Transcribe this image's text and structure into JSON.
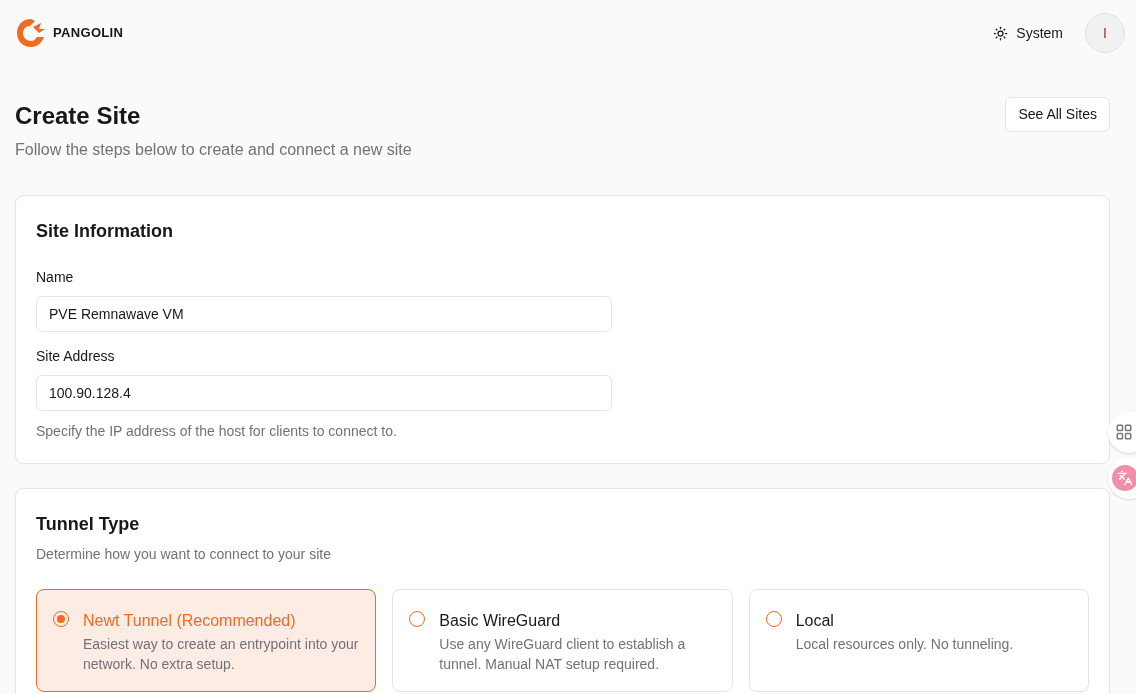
{
  "header": {
    "brand": "PANGOLIN",
    "theme_button": "System",
    "avatar": "I"
  },
  "page": {
    "title": "Create Site",
    "subtitle": "Follow the steps below to create and connect a new site",
    "see_all_button": "See All Sites"
  },
  "site_information": {
    "title": "Site Information",
    "fields": [
      {
        "label": "Name",
        "value": "PVE Remnawave VM"
      },
      {
        "label": "Site Address",
        "value": "100.90.128.4",
        "hint": "Specify the IP address of the host for clients to connect to."
      }
    ]
  },
  "tunnel_type": {
    "title": "Tunnel Type",
    "description": "Determine how you want to connect to your site",
    "options": [
      {
        "title": "Newt Tunnel (Recommended)",
        "description": "Easiest way to create an entrypoint into your network. No extra setup.",
        "selected": true
      },
      {
        "title": "Basic WireGuard",
        "description": "Use any WireGuard client to establish a tunnel. Manual NAT setup required.",
        "selected": false
      },
      {
        "title": "Local",
        "description": "Local resources only. No tunneling.",
        "selected": false
      }
    ]
  }
}
